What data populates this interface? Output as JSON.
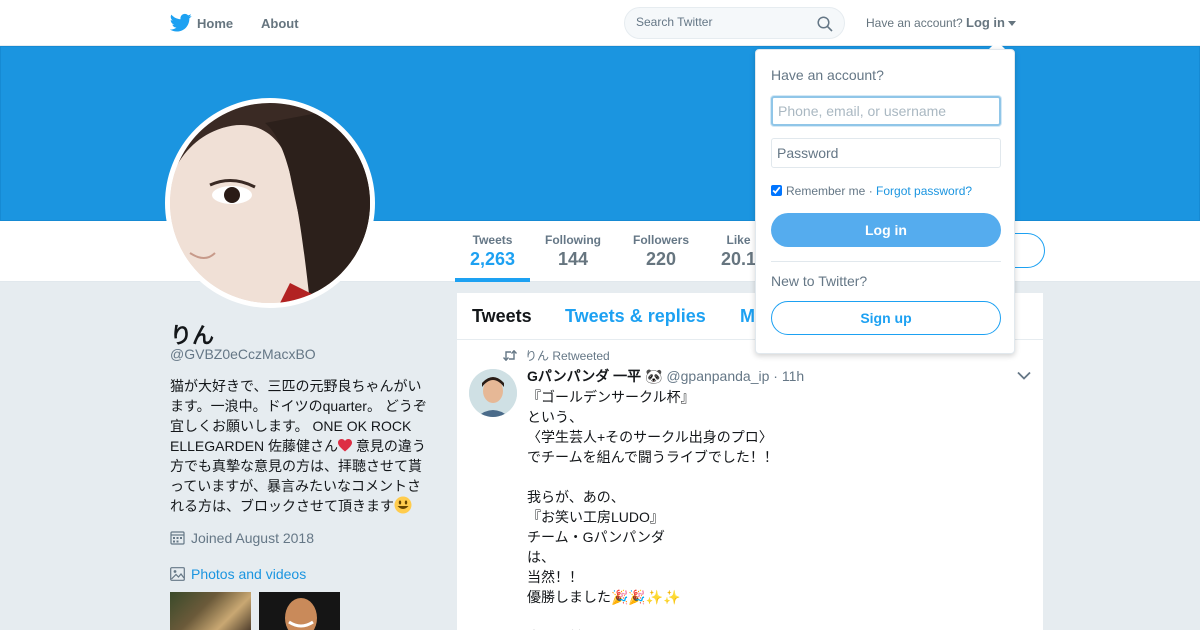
{
  "nav": {
    "home_label": "Home",
    "about_label": "About",
    "search_placeholder": "Search Twitter",
    "have_account": "Have an account?",
    "login_label": "Log in"
  },
  "profile": {
    "name": "りん",
    "handle": "@GVBZ0eCczMacxBO",
    "bio_part1": "猫が大好きで、三匹の元野良ちゃんがいます。一浪中。ドイツのquarter。 どうぞ宜しくお願いします。 ONE OK ROCK ELLEGARDEN 佐藤健さん",
    "bio_part2": " 意見の違う方でも真摯な意見の方は、拝聴させて貰っていますが、暴言みたいなコメントされる方は、ブロックさせて頂きます",
    "joined": "Joined August 2018",
    "photos_label": "Photos and videos"
  },
  "stats": [
    {
      "label": "Tweets",
      "value": "2,263"
    },
    {
      "label": "Following",
      "value": "144"
    },
    {
      "label": "Followers",
      "value": "220"
    },
    {
      "label": "Like",
      "value": "20.1"
    }
  ],
  "timeline": {
    "tabs": [
      "Tweets",
      "Tweets & replies",
      "M"
    ],
    "retweeted_by": "りん Retweeted",
    "tweet": {
      "author_name": "Gパンパンダ 一平",
      "author_handle": "@gpanpanda_ip",
      "time": "· 11h",
      "text": "『ゴールデンサークル杯』\nという、\n〈学生芸人+そのサークル出身のプロ〉\nでチームを組んで闘うライブでした！！\n\n我らが、あの、\n『お笑い工房LUDO』\nチーム・Gパンパンダ\nは、\n当然！！\n優勝しました🎉🎉✨✨\n\n当たり前ですよね！！"
    }
  },
  "login_dropdown": {
    "title": "Have an account?",
    "username_placeholder": "Phone, email, or username",
    "password_placeholder": "Password",
    "remember_label": "Remember me",
    "separator": " · ",
    "forgot_label": "Forgot password?",
    "login_button": "Log in",
    "new_to_twitter": "New to Twitter?",
    "signup_button": "Sign up"
  },
  "colors": {
    "accent": "#1da1f2",
    "banner": "#1b95e0",
    "login_button": "#55acee"
  }
}
